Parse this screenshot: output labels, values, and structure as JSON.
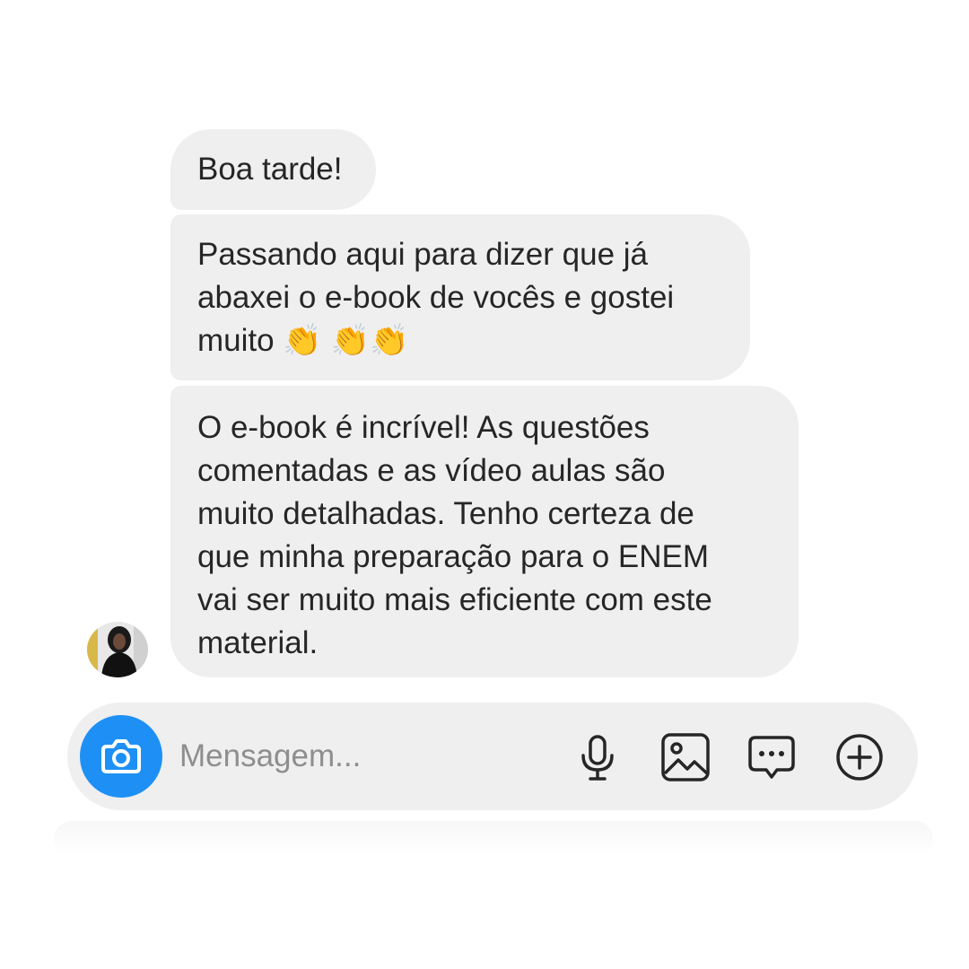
{
  "messages": [
    {
      "text": "Boa tarde!"
    },
    {
      "text": "Passando aqui para dizer que já\nabaxei o e-book de vocês e gostei\nmuito 👏 👏👏"
    },
    {
      "text": "O e-book é incrível! As questões\ncomentadas e as vídeo aulas são\nmuito detalhadas. Tenho certeza de\nque minha preparação para o ENEM\nvai ser muito mais eficiente com este\nmaterial."
    }
  ],
  "composer": {
    "placeholder": "Mensagem...",
    "icons": [
      "camera-icon",
      "microphone-icon",
      "image-icon",
      "sticker-chat-icon",
      "plus-circle-icon"
    ]
  },
  "colors": {
    "bubble": "#efefef",
    "text": "#262626",
    "camera_button": "#1e90f5",
    "placeholder": "#8e8e8e"
  }
}
